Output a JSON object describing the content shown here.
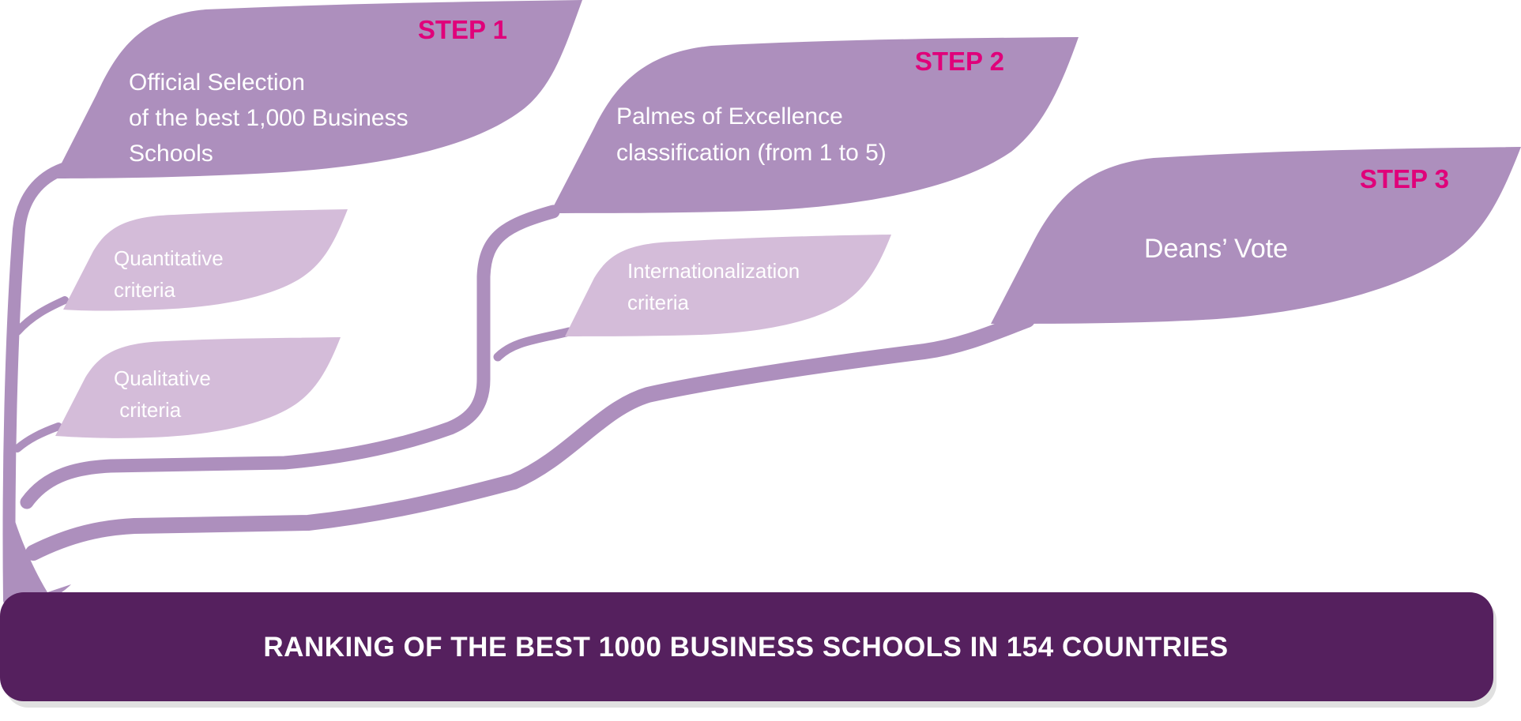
{
  "colors": {
    "branch": "#ad8fbd",
    "leaf_dark": "#ad8fbd",
    "leaf_light": "#d4bcd9",
    "step_label": "#e0007a",
    "footer_bg": "#55205e",
    "footer_text": "#ffffff",
    "leaf_text": "#ffffff"
  },
  "steps": [
    {
      "label": "STEP 1",
      "lines": [
        "Official Selection",
        "of the best 1,000 Business",
        "Schools"
      ]
    },
    {
      "label": "STEP 2",
      "lines": [
        "Palmes of Excellence",
        "classification (from 1 to 5)"
      ]
    },
    {
      "label": "STEP 3",
      "lines": [
        "Deans’ Vote"
      ]
    }
  ],
  "criteria": [
    {
      "lines": [
        "Quantitative",
        "criteria"
      ]
    },
    {
      "lines": [
        "Qualitative",
        " criteria"
      ]
    },
    {
      "lines": [
        "Internationalization",
        "criteria"
      ]
    }
  ],
  "footer": {
    "text": "RANKING OF THE BEST 1000 BUSINESS SCHOOLS IN 154 COUNTRIES"
  }
}
